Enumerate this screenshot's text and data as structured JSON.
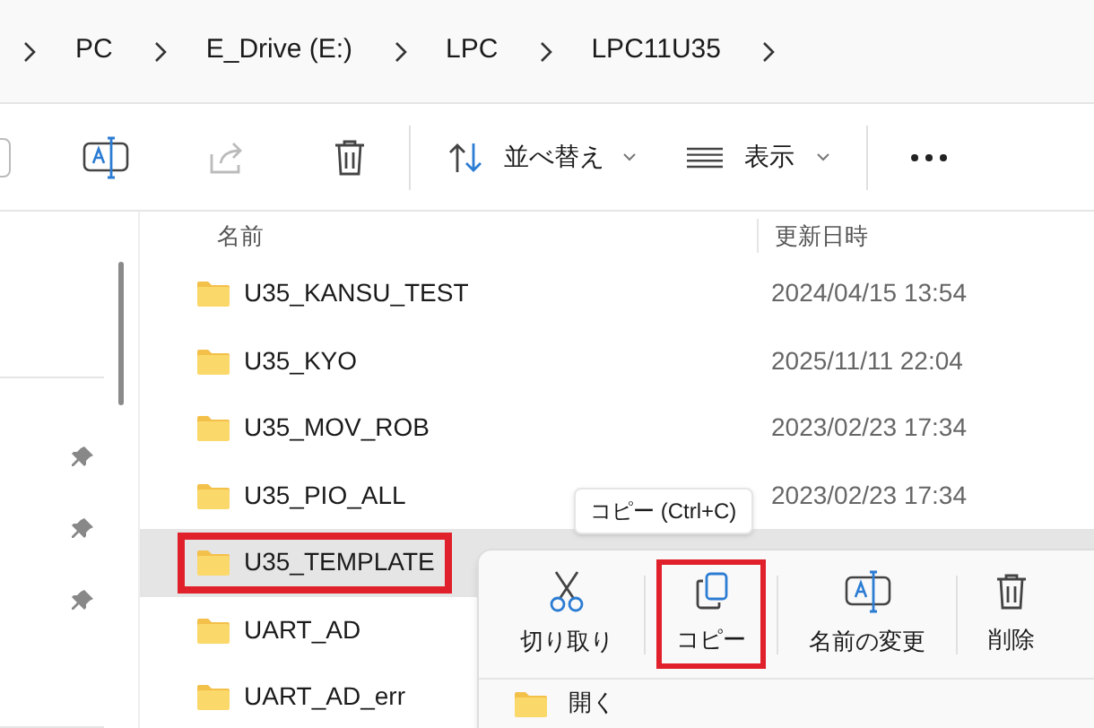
{
  "breadcrumb": [
    "PC",
    "E_Drive (E:)",
    "LPC",
    "LPC11U35"
  ],
  "toolbar": {
    "sort_label": "並べ替え",
    "view_label": "表示"
  },
  "columns": [
    "名前",
    "更新日時"
  ],
  "rows": [
    {
      "name": "U35_KANSU_TEST",
      "modified": "2024/04/15 13:54",
      "selected": false,
      "highlighted": false
    },
    {
      "name": "U35_KYO",
      "modified": "2025/11/11 22:04",
      "selected": false,
      "highlighted": false
    },
    {
      "name": "U35_MOV_ROB",
      "modified": "2023/02/23 17:34",
      "selected": false,
      "highlighted": false
    },
    {
      "name": "U35_PIO_ALL",
      "modified": "2023/02/23 17:34",
      "selected": false,
      "highlighted": false
    },
    {
      "name": "U35_TEMPLATE",
      "selected": true,
      "highlighted": true
    },
    {
      "name": "UART_AD",
      "selected": false,
      "highlighted": false
    },
    {
      "name": "UART_AD_err",
      "selected": false,
      "highlighted": false
    }
  ],
  "context_menu": {
    "tooltip": "コピー (Ctrl+C)",
    "actions": [
      {
        "kind": "cut",
        "label": "切り取り",
        "highlighted": false
      },
      {
        "kind": "copy",
        "label": "コピー",
        "highlighted": true
      },
      {
        "kind": "rename",
        "label": "名前の変更",
        "highlighted": false
      },
      {
        "kind": "delete",
        "label": "削除",
        "highlighted": false
      }
    ],
    "items": [
      {
        "label": "開く"
      }
    ]
  }
}
